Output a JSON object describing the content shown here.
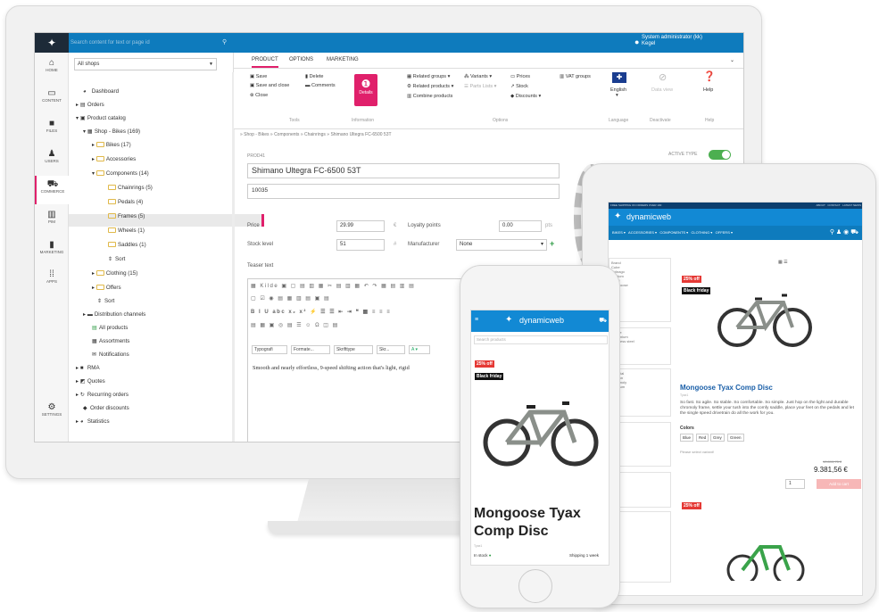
{
  "topbar": {
    "search_placeholder": "Search content for text or page id",
    "user": "System administrator (kk)",
    "user_sub": "Kegel"
  },
  "rail": [
    {
      "icon": "home-icon",
      "label": "HOME"
    },
    {
      "icon": "content-icon",
      "label": "CONTENT"
    },
    {
      "icon": "files-icon",
      "label": "FILES"
    },
    {
      "icon": "users-icon",
      "label": "USERS"
    },
    {
      "icon": "commerce-icon",
      "label": "COMMERCE"
    },
    {
      "icon": "pim-icon",
      "label": "PIM"
    },
    {
      "icon": "marketing-icon",
      "label": "MARKETING"
    },
    {
      "icon": "apps-icon",
      "label": "APPS"
    },
    {
      "icon": "settings-icon",
      "label": "SETTINGS"
    }
  ],
  "tree": {
    "shop_select": "All shops",
    "items": [
      "Dashboard",
      "Orders",
      "Product catalog",
      "Shop - Bikes (169)",
      "Bikes (17)",
      "Accessories",
      "Components (14)",
      "Chainrings (5)",
      "Pedals (4)",
      "Frames (5)",
      "Wheels (1)",
      "Saddles (1)",
      "Sort",
      "Clothing (15)",
      "Offers",
      "Sort",
      "Distribution channels",
      "All products",
      "Assortments",
      "Notifications",
      "RMA",
      "Quotes",
      "Recurring orders",
      "Order discounts",
      "Statistics"
    ]
  },
  "tabs": [
    "PRODUCT",
    "OPTIONS",
    "MARKETING"
  ],
  "ribbon": {
    "tools": [
      "Save",
      "Save and close",
      "Close",
      "Delete",
      "Comments"
    ],
    "tools_label": "Tools",
    "details": "Details",
    "information_label": "Information",
    "options": [
      "Related groups",
      "Variants",
      "Prices",
      "VAT groups",
      "Related products",
      "Parts Lists",
      "Stock",
      "Combine products",
      "Discounts"
    ],
    "options_label": "Options",
    "language": "English",
    "language_label": "Language",
    "deactivate": "Data view",
    "deactivate_label": "Deactivate",
    "help": "Help",
    "help_label": "Help"
  },
  "breadcrumb": "» Shop - Bikes » Components » Chainrings » Shimano Ultegra FC-6500 53T",
  "product": {
    "id_label": "PROD41",
    "active_type": "ACTIVE TYPE",
    "name": "Shimano Ultegra FC-6500 53T",
    "number": "10035",
    "price_label": "Price",
    "price": "29.99",
    "currency": "€",
    "loyalty_label": "Loyalty points",
    "loyalty": "0.00",
    "pts": "pts",
    "stock_label": "Stock level",
    "stock": "51",
    "stock_unit": "#",
    "manufacturer_label": "Manufacturer",
    "manufacturer": "None",
    "teaser_label": "Teaser text",
    "format_dropdowns": [
      "Typografi",
      "Formate...",
      "Skrifttype",
      "Skr..."
    ],
    "teaser_text": "Smooth and nearly effortless, 9-speed shifting action that's light, rigid"
  },
  "tablet": {
    "topstrip": "FREE SHIPPING ON ORDERS OVER 100",
    "top_links": [
      "ABOUT",
      "CONTACT",
      "LATEST NEWS"
    ],
    "logo": "dynamicweb",
    "nav": [
      "BIKES",
      "ACCESSORIES",
      "COMPONENTS",
      "CLOTHING",
      "OFFERS"
    ],
    "filters": [
      "Brand",
      "Cube",
      "Colnago",
      "Custom",
      "Giant",
      "Mongoose",
      "Frame",
      "Aluminium",
      "Stainless steel",
      "Material",
      "Carbon",
      "Chromoly",
      "Titanium"
    ],
    "badge_off": "25% off",
    "badge_bf": "Black friday",
    "product_title": "Mongoose Tyax Comp Disc",
    "product_sub": "Tyax1",
    "description": "So fast. So agile. So stable. So comfortable. So simple. Just hop on the light and durable chromoly frame, settle your tush into the comfy saddle, place your feet on the pedals and let the single speed drivetrain do all the work for you.",
    "colors_label": "Colors",
    "colors": [
      "Blue",
      "Red",
      "Grey",
      "Green"
    ],
    "variant_note": "Please select variant!",
    "old_price": "10.890,75 €",
    "price": "9.381,56 €",
    "qty": "1",
    "add_to_cart": "Add to cart",
    "badge_off2": "25% off"
  },
  "phone": {
    "logo": "dynamicweb",
    "search_placeholder": "Search products",
    "badge_off": "25% off",
    "badge_bf": "Black friday",
    "title": "Mongoose Tyax Comp Disc",
    "sub": "Tyax1",
    "stock": "In stock",
    "shipping": "Shipping 1 week"
  }
}
